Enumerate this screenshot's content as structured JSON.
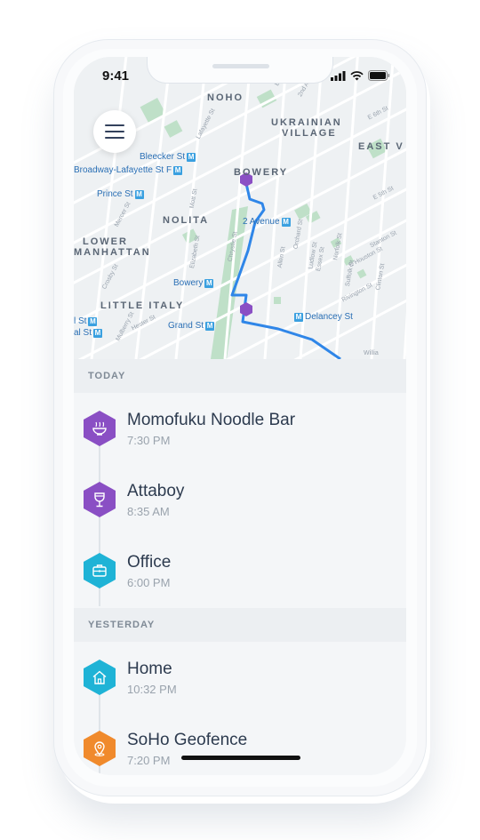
{
  "status_bar": {
    "time": "9:41"
  },
  "map": {
    "neighborhoods": [
      "NOHO",
      "UKRAINIAN",
      "VILLAGE",
      "EAST V",
      "BOWERY",
      "NOLITA",
      "LOWER",
      "MANHATTAN",
      "LITTLE ITALY"
    ],
    "stations": [
      "Bleecker St",
      "Broadway-Lafayette St F",
      "Prince St",
      "2 Avenue",
      "Bowery",
      "Grand St",
      "Delancey St",
      "l St",
      "al St"
    ],
    "streets": [
      "E 7th St",
      "2nd Ave",
      "E 6th St",
      "E 5th St",
      "Lafayette St",
      "Mott St",
      "Elizabeth St",
      "Chrystie St",
      "Allen St",
      "Orchard St",
      "Ludlow St",
      "Essex St",
      "Norfolk St",
      "Suffolk St",
      "E Houston St",
      "Clinton St",
      "Rivington St",
      "Stanton St",
      "Mulberry St",
      "Hester St",
      "Crosby St",
      "Mercer St",
      "Willia"
    ],
    "route_color": "#2f86e8",
    "pin_color": "#8a4fc4"
  },
  "sections": [
    {
      "header": "TODAY",
      "items": [
        {
          "title": "Momofuku Noodle Bar",
          "time": "7:30 PM",
          "icon": "noodle-bowl-icon",
          "color": "#8a4fc4"
        },
        {
          "title": "Attaboy",
          "time": "8:35 AM",
          "icon": "wine-glass-icon",
          "color": "#8a4fc4"
        },
        {
          "title": "Office",
          "time": "6:00 PM",
          "icon": "briefcase-icon",
          "color": "#1fb3d6"
        }
      ]
    },
    {
      "header": "YESTERDAY",
      "items": [
        {
          "title": "Home",
          "time": "10:32 PM",
          "icon": "house-icon",
          "color": "#1fb3d6"
        },
        {
          "title": "SoHo Geofence",
          "time": "7:20 PM",
          "icon": "location-pin-icon",
          "color": "#f08a2c"
        }
      ]
    }
  ]
}
